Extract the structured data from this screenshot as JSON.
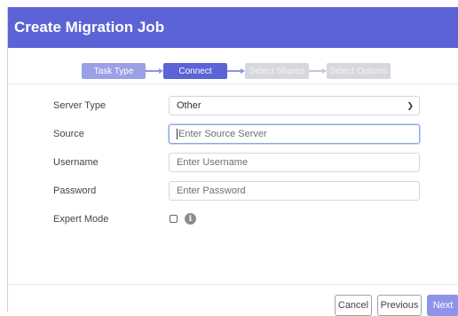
{
  "dialog": {
    "title": "Create Migration Job"
  },
  "stepper": {
    "steps": [
      {
        "label": "Task Type",
        "state": "done"
      },
      {
        "label": "Connect",
        "state": "active"
      },
      {
        "label": "Select Shares",
        "state": "pending"
      },
      {
        "label": "Select Options",
        "state": "pending"
      }
    ]
  },
  "form": {
    "server_type": {
      "label": "Server Type",
      "value": "Other"
    },
    "source": {
      "label": "Source",
      "placeholder": "Enter Source Server"
    },
    "username": {
      "label": "Username",
      "placeholder": "Enter Username"
    },
    "password": {
      "label": "Password",
      "placeholder": "Enter Password"
    },
    "expert_mode": {
      "label": "Expert Mode",
      "checked": false,
      "info_icon": "info-icon"
    }
  },
  "footer": {
    "cancel_label": "Cancel",
    "previous_label": "Previous",
    "next_label": "Next"
  },
  "colors": {
    "accent": "#5b63d6",
    "accent_light": "#9aa0e6",
    "pending": "#d6d8dd"
  }
}
